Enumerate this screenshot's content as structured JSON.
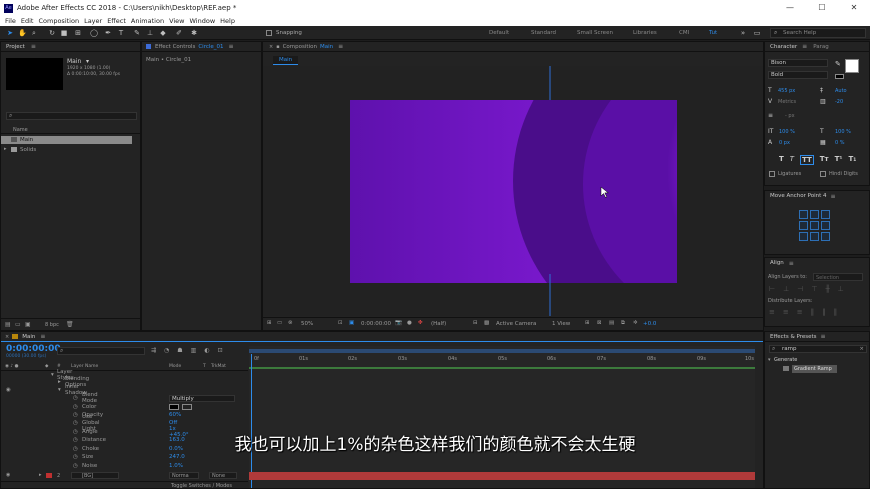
{
  "window": {
    "title": "Adobe After Effects CC 2018 - C:\\Users\\nikh\\Desktop\\REF.aep *",
    "logo": "Ae"
  },
  "menu": [
    "File",
    "Edit",
    "Composition",
    "Layer",
    "Effect",
    "Animation",
    "View",
    "Window",
    "Help"
  ],
  "toolbar": {
    "snapping_label": "Snapping",
    "workspaces": [
      "Default",
      "Standard",
      "Small Screen",
      "Libraries",
      "CMI"
    ],
    "active_workspace": "Tut",
    "search_placeholder": "Search Help"
  },
  "project": {
    "tab": "Project",
    "comp_name": "Main",
    "comp_info_1": "1920 x 1080 (1.00)",
    "comp_info_2": "Δ 0:00:10:00, 30.00 fps",
    "col_name": "Name",
    "items": [
      "Main",
      "Solids"
    ],
    "bpc": "8 bpc"
  },
  "effect_controls": {
    "tab": "Effect Controls",
    "target": "Circle_01",
    "breadcrumb": "Main • Circle_01"
  },
  "composition": {
    "tab": "Composition",
    "name": "Main",
    "sub_tab": "Main",
    "footer": {
      "zoom": "50%",
      "time": "0:00:00:00",
      "resolution": "(Half)",
      "camera": "Active Camera",
      "view": "1 View",
      "exposure": "+0.0"
    }
  },
  "character": {
    "tab": "Character",
    "tab2": "Parag",
    "font": "Bison",
    "style": "Bold",
    "size": "455 px",
    "leading": "Auto",
    "tracking": "-20",
    "kerning": "Metrics",
    "stroke": "- px",
    "vscale": "100 %",
    "hscale": "100 %",
    "baseline": "0 px",
    "tsume": "0 %",
    "ligatures": "Ligatures",
    "hindi": "Hindi Digits"
  },
  "anchor": {
    "title": "Move Anchor Point 4"
  },
  "align": {
    "title": "Align",
    "align_to": "Align Layers to:",
    "selection": "Selection",
    "distribute": "Distribute Layers:"
  },
  "effects": {
    "title": "Effects & Presets",
    "search": "ramp",
    "category": "Generate",
    "item": "Gradient Ramp"
  },
  "timeline": {
    "tab": "Main",
    "timecode": "0:00:00:00",
    "frames": "00000 (30.00 fps)",
    "columns": {
      "layer_name": "Layer Name",
      "mode": "Mode",
      "t": "T",
      "trkmat": "TrkMat"
    },
    "ruler": [
      "0f",
      "01s",
      "02s",
      "03s",
      "04s",
      "05s",
      "06s",
      "07s",
      "08s",
      "09s",
      "10s"
    ],
    "rows": [
      {
        "label": "Layer Styles",
        "indent": 1
      },
      {
        "label": "Blending Options",
        "indent": 2
      },
      {
        "label": "Inner Shadow",
        "indent": 2
      },
      {
        "label": "Blend Mode",
        "indent": 3,
        "value": "Multiply"
      },
      {
        "label": "Color",
        "indent": 3,
        "value": ""
      },
      {
        "label": "Opacity",
        "indent": 3,
        "value": "60%"
      },
      {
        "label": "Use Global Light",
        "indent": 3,
        "value": "Off"
      },
      {
        "label": "Angle",
        "indent": 3,
        "value": "1x +45.0°"
      },
      {
        "label": "Distance",
        "indent": 3,
        "value": "163.0"
      },
      {
        "label": "Choke",
        "indent": 3,
        "value": "0.0%"
      },
      {
        "label": "Size",
        "indent": 3,
        "value": "247.0"
      },
      {
        "label": "Noise",
        "indent": 3,
        "value": "1.0%"
      }
    ],
    "bg_layer": {
      "num": "2",
      "name": "[BG]",
      "mode": "Norma",
      "trkmat": "None"
    },
    "toggle": "Toggle Switches / Modes"
  },
  "subtitle": "我也可以加上1%的杂色这样我们的颜色就不会太生硬",
  "colors": {
    "accent": "#2d8ceb",
    "comp_purple": "#7a12d4",
    "layer_red": "#b03a3a"
  }
}
